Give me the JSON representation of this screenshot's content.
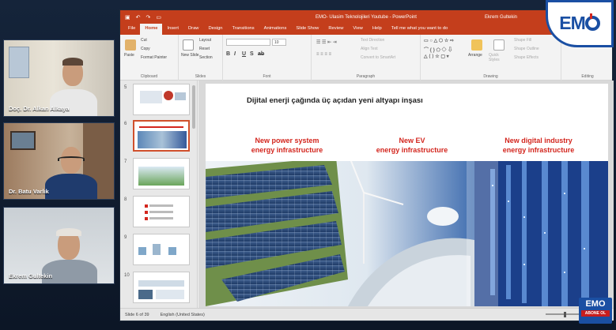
{
  "participants": [
    {
      "name": "Doç. Dr. Alkan Alkaya"
    },
    {
      "name": "Dr. Batu Varlık"
    },
    {
      "name": "Ekrem Gultekin"
    }
  ],
  "window": {
    "title": "EMO- Ulasim Teknolojileri Youtube - PowerPoint",
    "user": "Ekrem Gultekin"
  },
  "ribbon_tabs": [
    "File",
    "Home",
    "Insert",
    "Draw",
    "Design",
    "Transitions",
    "Animations",
    "Slide Show",
    "Review",
    "View",
    "Help",
    "Tell me what you want to do"
  ],
  "ribbon": {
    "clipboard": {
      "label": "Clipboard",
      "paste": "Paste",
      "cut": "Cut",
      "copy": "Copy",
      "format_painter": "Format Painter"
    },
    "slides": {
      "label": "Slides",
      "new_slide": "New Slide",
      "layout": "Layout",
      "reset": "Reset",
      "section": "Section"
    },
    "font": {
      "label": "Font",
      "size": "10",
      "buttons": [
        "B",
        "I",
        "U",
        "S",
        "ab"
      ]
    },
    "paragraph": {
      "label": "Paragraph",
      "text_direction": "Text Direction",
      "align_text": "Align Text",
      "convert": "Convert to SmartArt"
    },
    "drawing": {
      "label": "Drawing",
      "arrange": "Arrange",
      "quick_styles": "Quick Styles",
      "shape_fill": "Shape Fill",
      "shape_outline": "Shape Outline",
      "shape_effects": "Shape Effects"
    },
    "editing": {
      "label": "Editing"
    }
  },
  "thumbnails": [
    {
      "num": "5"
    },
    {
      "num": "6"
    },
    {
      "num": "7"
    },
    {
      "num": "8"
    },
    {
      "num": "9"
    },
    {
      "num": "10"
    }
  ],
  "slide": {
    "title": "Dijital enerji çağında üç açıdan yeni altyapı inşası",
    "columns": [
      {
        "line1": "New power system",
        "line2": "energy infrastructure"
      },
      {
        "line1": "New EV",
        "line2": "energy infrastructure"
      },
      {
        "line1": "New digital industry",
        "line2": "energy infrastructure"
      }
    ]
  },
  "status": {
    "slide_info": "Slide 6 of 39",
    "language": "English (United States)"
  },
  "logo": {
    "text": "EMO",
    "subtext": "ABONE OL"
  },
  "colors": {
    "accent": "#c43e1c",
    "slide_heading": "#d3261e",
    "logo_blue": "#1a4fa3"
  }
}
